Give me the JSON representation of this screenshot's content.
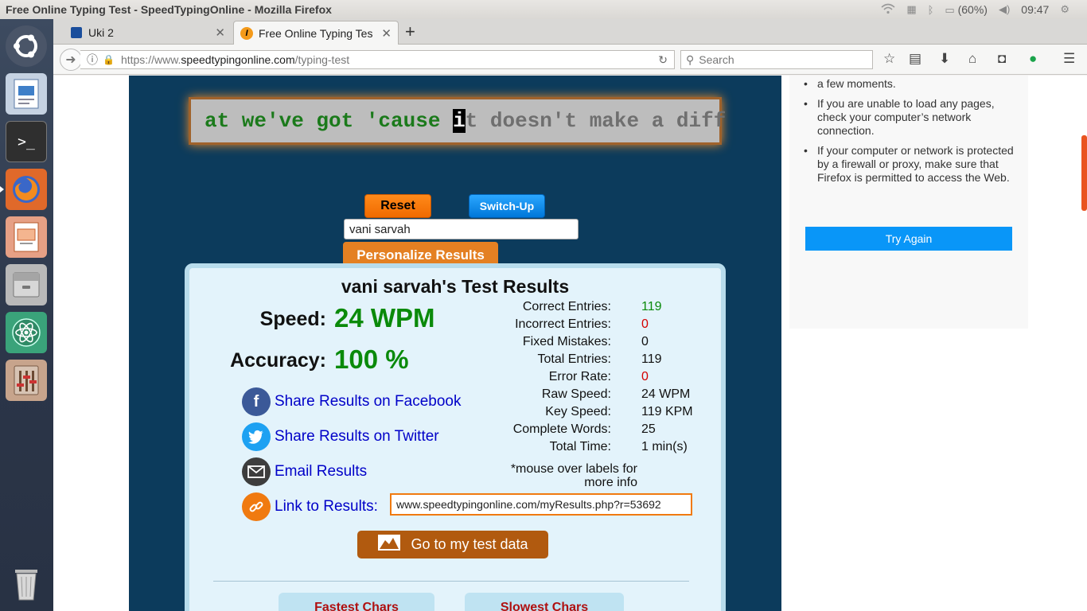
{
  "window_title": "Free Online Typing Test - SpeedTypingOnline - Mozilla Firefox",
  "tray": {
    "battery": "(60%)",
    "clock": "09:47"
  },
  "tabs": [
    {
      "label": "Uki 2"
    },
    {
      "label": "Free Online Typing Tes"
    }
  ],
  "url": {
    "scheme": "https://www.",
    "host": "speedtypingonline.com",
    "path": "/typing-test"
  },
  "search_placeholder": "Search",
  "typing": {
    "typed": "at we've got 'cause ",
    "cursor": "i",
    "untyped": "t doesn't make a diff"
  },
  "buttons": {
    "reset": "Reset",
    "switch_up": "Switch-Up",
    "personalize": "Personalize Results",
    "test_data": "Go to my test data"
  },
  "name_input_value": "vani sarvah",
  "results": {
    "title": "vani sarvah's Test Results",
    "speed_label": "Speed:",
    "speed_value": "24 WPM",
    "accuracy_label": "Accuracy:",
    "accuracy_value": "100 %",
    "stats": [
      {
        "label": "Correct Entries:",
        "value": "119",
        "color": "#0a8a0a"
      },
      {
        "label": "Incorrect Entries:",
        "value": "0",
        "color": "#d40000"
      },
      {
        "label": "Fixed Mistakes:",
        "value": "0",
        "color": "#111111"
      },
      {
        "label": "Total Entries:",
        "value": "119",
        "color": "#111111"
      },
      {
        "label": "Error Rate:",
        "value": "0",
        "color": "#d40000"
      },
      {
        "label": "Raw Speed:",
        "value": "24 WPM",
        "color": "#111111"
      },
      {
        "label": "Key Speed:",
        "value": "119 KPM",
        "color": "#111111"
      },
      {
        "label": "Complete Words:",
        "value": "25",
        "color": "#111111"
      },
      {
        "label": "Total Time:",
        "value": "1 min(s)",
        "color": "#111111"
      }
    ],
    "mouse_note": "*mouse over labels for more info",
    "share": {
      "facebook": "Share Results on Facebook",
      "twitter": "Share Results on Twitter",
      "email": "Email Results",
      "link": "Link to Results:"
    },
    "link_value": "www.speedtypingonline.com/myResults.php?r=53692",
    "fastest_chars": "Fastest Chars",
    "slowest_chars": "Slowest Chars"
  },
  "side_panel": {
    "items": [
      "a few moments.",
      "If you are unable to load any pages, check your computer’s network connection.",
      "If your computer or network is protected by a firewall or proxy, make sure that Firefox is permitted to access the Web."
    ],
    "try_again": "Try Again"
  }
}
